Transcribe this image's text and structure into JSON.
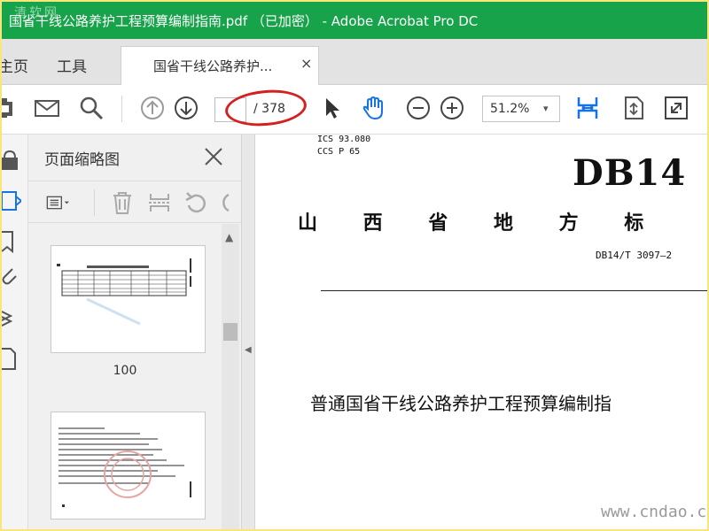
{
  "window": {
    "title": "国省干线公路养护工程预算编制指南.pdf （已加密） - Adobe Acrobat Pro DC",
    "watermark": "清软网"
  },
  "nav": {
    "home_label": "主页",
    "tools_label": "工具",
    "tab_label": "国省干线公路养护...",
    "tab_close": "×"
  },
  "toolbar": {
    "page_current": "",
    "page_total": "/ 378",
    "zoom": "51.2%",
    "zoom_caret": "▾",
    "highlight_color": "#d6201f",
    "accent": "#1473e6"
  },
  "panel": {
    "title": "页面缩略图",
    "close": "×",
    "scroll_up": "▲",
    "thumbs": [
      {
        "label": "100"
      },
      {
        "label": ""
      }
    ]
  },
  "splitter": {
    "arrow": "◀"
  },
  "document": {
    "ics": "ICS   93.080",
    "ccs": "CCS  P  65",
    "logo": "DB14",
    "standard_title": "山 西 省 地 方 标",
    "code": "DB14/T 3097—2",
    "doc_title": "普通国省干线公路养护工程预算编制指",
    "site_watermark": "www.cndao.com"
  },
  "colors": {
    "titlebar": "#16a34a",
    "frame": "#f7e67a"
  }
}
